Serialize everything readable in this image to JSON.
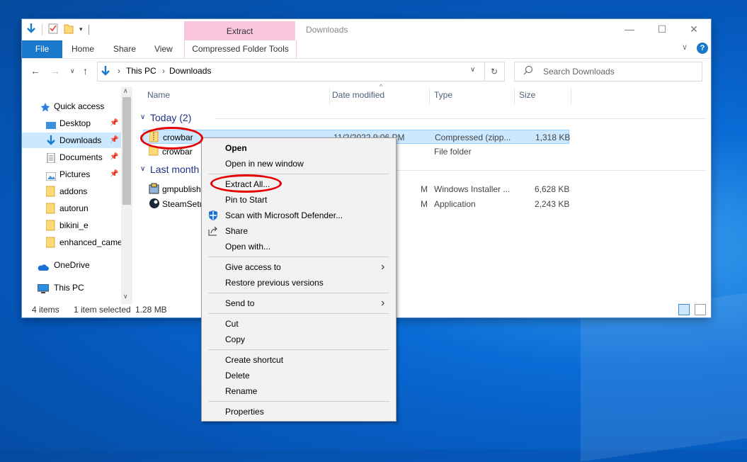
{
  "window": {
    "title": "Downloads",
    "ribbon_context_group": "Extract",
    "ribbon_context_tab": "Compressed Folder Tools",
    "tabs": [
      "File",
      "Home",
      "Share",
      "View"
    ],
    "accent": "#1979ca",
    "context_color": "#f9c7dd"
  },
  "address": {
    "breadcrumb": [
      "This PC",
      "Downloads"
    ],
    "search_placeholder": "Search Downloads"
  },
  "sidebar": {
    "items": [
      {
        "label": "Quick access",
        "icon": "star-icon"
      },
      {
        "label": "Desktop",
        "icon": "desktop-icon"
      },
      {
        "label": "Downloads",
        "icon": "download-arrow-icon"
      },
      {
        "label": "Documents",
        "icon": "documents-icon"
      },
      {
        "label": "Pictures",
        "icon": "pictures-icon"
      },
      {
        "label": "addons",
        "icon": "folder-icon"
      },
      {
        "label": "autorun",
        "icon": "folder-icon"
      },
      {
        "label": "bikini_e",
        "icon": "folder-icon"
      },
      {
        "label": "enhanced_came",
        "icon": "folder-icon"
      },
      {
        "label": "OneDrive",
        "icon": "cloud-icon"
      },
      {
        "label": "This PC",
        "icon": "computer-icon"
      }
    ]
  },
  "columns": [
    "Name",
    "Date modified",
    "Type",
    "Size"
  ],
  "groups": [
    {
      "label": "Today (2)",
      "rows": [
        {
          "name": "crowbar",
          "date": "11/2/2022 9:06 PM",
          "type": "Compressed (zipp...",
          "size": "1,318 KB"
        },
        {
          "name": "crowbar",
          "date": "",
          "type": "File folder",
          "size": ""
        }
      ]
    },
    {
      "label": "Last month",
      "rows": [
        {
          "name": "gmpublish",
          "date": "M",
          "type": "Windows Installer ...",
          "size": "6,628 KB"
        },
        {
          "name": "SteamSetu",
          "date": "M",
          "type": "Application",
          "size": "2,243 KB"
        }
      ]
    }
  ],
  "status": {
    "count": "4 items",
    "selection": "1 item selected",
    "size": "1.28 MB"
  },
  "context_menu": {
    "open": "Open",
    "open_new_window": "Open in new window",
    "extract_all": "Extract All...",
    "pin_to_start": "Pin to Start",
    "scan_defender": "Scan with Microsoft Defender...",
    "share": "Share",
    "open_with": "Open with...",
    "give_access": "Give access to",
    "restore_versions": "Restore previous versions",
    "send_to": "Send to",
    "cut": "Cut",
    "copy": "Copy",
    "create_shortcut": "Create shortcut",
    "delete": "Delete",
    "rename": "Rename",
    "properties": "Properties"
  }
}
